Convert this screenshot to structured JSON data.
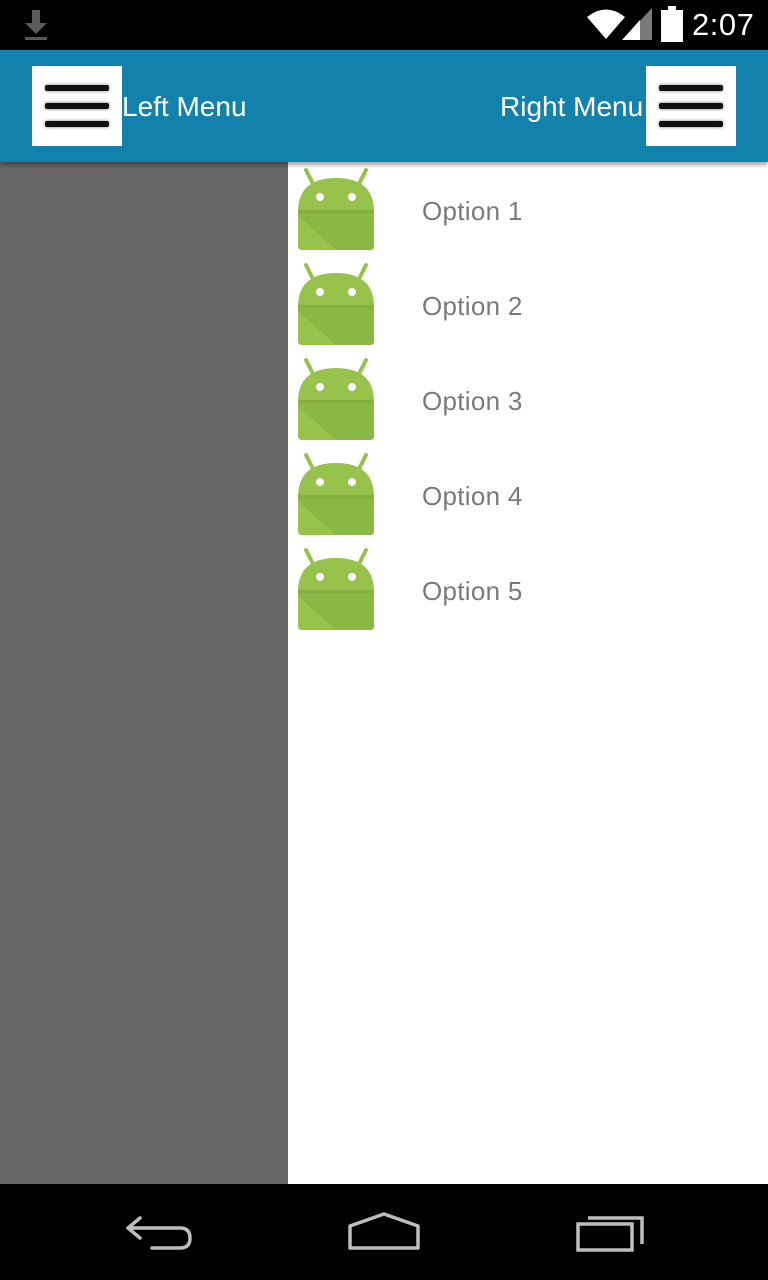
{
  "status_bar": {
    "time": "2:07",
    "icons": [
      "download-icon",
      "wifi-icon",
      "signal-icon",
      "battery-icon"
    ]
  },
  "action_bar": {
    "left_menu_label": "Left Menu",
    "right_menu_label": "Right Menu",
    "background_color": "#1282ad"
  },
  "left_panel": {
    "background_color": "#666666"
  },
  "right_drawer": {
    "items": [
      {
        "label": "Option 1",
        "icon": "android-icon"
      },
      {
        "label": "Option 2",
        "icon": "android-icon"
      },
      {
        "label": "Option 3",
        "icon": "android-icon"
      },
      {
        "label": "Option 4",
        "icon": "android-icon"
      },
      {
        "label": "Option 5",
        "icon": "android-icon"
      }
    ]
  },
  "nav_bar": {
    "buttons": [
      "back-icon",
      "home-icon",
      "recents-icon"
    ]
  }
}
